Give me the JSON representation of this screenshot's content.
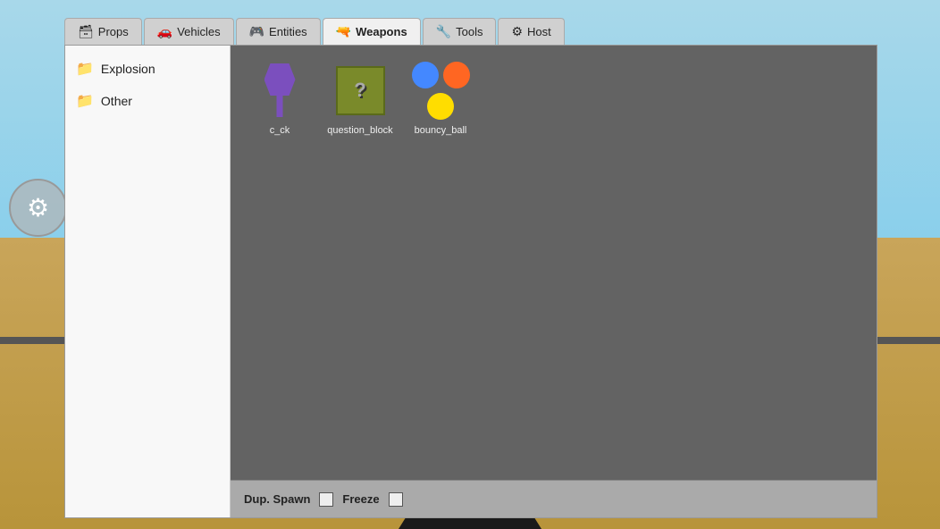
{
  "background": {
    "sky_color_top": "#a8d8ea",
    "sky_color_bottom": "#87ceeb",
    "ground_color_top": "#c9a55a",
    "ground_color_bottom": "#b8943a"
  },
  "tabs": [
    {
      "id": "props",
      "label": "Props",
      "icon": "🗃",
      "active": false
    },
    {
      "id": "vehicles",
      "label": "Vehicles",
      "icon": "🚗",
      "active": false
    },
    {
      "id": "entities",
      "label": "Entities",
      "icon": "🎮",
      "active": false
    },
    {
      "id": "weapons",
      "label": "Weapons",
      "icon": "🔫",
      "active": true
    },
    {
      "id": "tools",
      "label": "Tools",
      "icon": "🔧",
      "active": false
    },
    {
      "id": "host",
      "label": "Host",
      "icon": "⚙",
      "active": false
    }
  ],
  "sidebar": {
    "items": [
      {
        "id": "explosion",
        "label": "Explosion"
      },
      {
        "id": "other",
        "label": "Other"
      }
    ]
  },
  "content": {
    "items": [
      {
        "id": "c_ck",
        "label": "c_ck",
        "type": "ck-shape"
      },
      {
        "id": "question_block",
        "label": "question_block",
        "type": "q-block"
      },
      {
        "id": "bouncy_ball",
        "label": "bouncy_ball",
        "type": "balls"
      }
    ]
  },
  "bottom_bar": {
    "dup_spawn_label": "Dup. Spawn",
    "freeze_label": "Freeze"
  },
  "wrench_icon": "⚙"
}
